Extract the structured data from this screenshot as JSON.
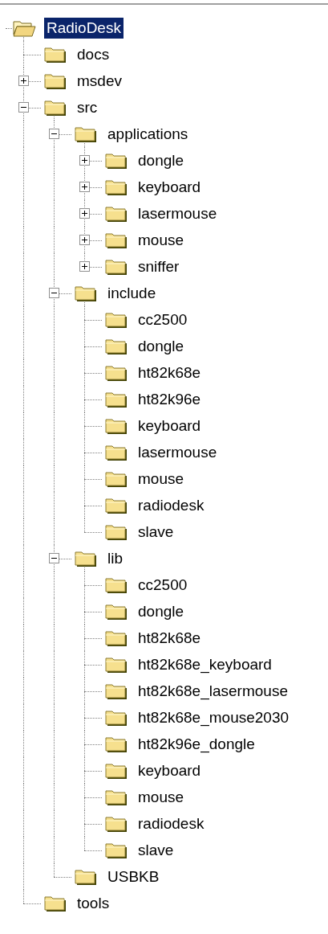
{
  "tree": {
    "label": "RadioDesk",
    "selected": true,
    "children": [
      {
        "label": "docs",
        "selected": false
      },
      {
        "label": "msdev",
        "selected": false,
        "expanded": false
      },
      {
        "label": "src",
        "selected": false,
        "expanded": true,
        "children": [
          {
            "label": "applications",
            "selected": false,
            "expanded": true,
            "children": [
              {
                "label": "dongle",
                "selected": false,
                "expanded": false
              },
              {
                "label": "keyboard",
                "selected": false,
                "expanded": false
              },
              {
                "label": "lasermouse",
                "selected": false,
                "expanded": false
              },
              {
                "label": "mouse",
                "selected": false,
                "expanded": false
              },
              {
                "label": "sniffer",
                "selected": false,
                "expanded": false
              }
            ]
          },
          {
            "label": "include",
            "selected": false,
            "expanded": true,
            "children": [
              {
                "label": "cc2500",
                "selected": false
              },
              {
                "label": "dongle",
                "selected": false
              },
              {
                "label": "ht82k68e",
                "selected": false
              },
              {
                "label": "ht82k96e",
                "selected": false
              },
              {
                "label": "keyboard",
                "selected": false
              },
              {
                "label": "lasermouse",
                "selected": false
              },
              {
                "label": "mouse",
                "selected": false
              },
              {
                "label": "radiodesk",
                "selected": false
              },
              {
                "label": "slave",
                "selected": false
              }
            ]
          },
          {
            "label": "lib",
            "selected": false,
            "expanded": true,
            "children": [
              {
                "label": "cc2500",
                "selected": false
              },
              {
                "label": "dongle",
                "selected": false
              },
              {
                "label": "ht82k68e",
                "selected": false
              },
              {
                "label": "ht82k68e_keyboard",
                "selected": false
              },
              {
                "label": "ht82k68e_lasermouse",
                "selected": false
              },
              {
                "label": "ht82k68e_mouse2030",
                "selected": false
              },
              {
                "label": "ht82k96e_dongle",
                "selected": false
              },
              {
                "label": "keyboard",
                "selected": false
              },
              {
                "label": "mouse",
                "selected": false
              },
              {
                "label": "radiodesk",
                "selected": false
              },
              {
                "label": "slave",
                "selected": false
              }
            ]
          },
          {
            "label": "USBKB",
            "selected": false
          }
        ]
      },
      {
        "label": "tools",
        "selected": false
      }
    ]
  }
}
